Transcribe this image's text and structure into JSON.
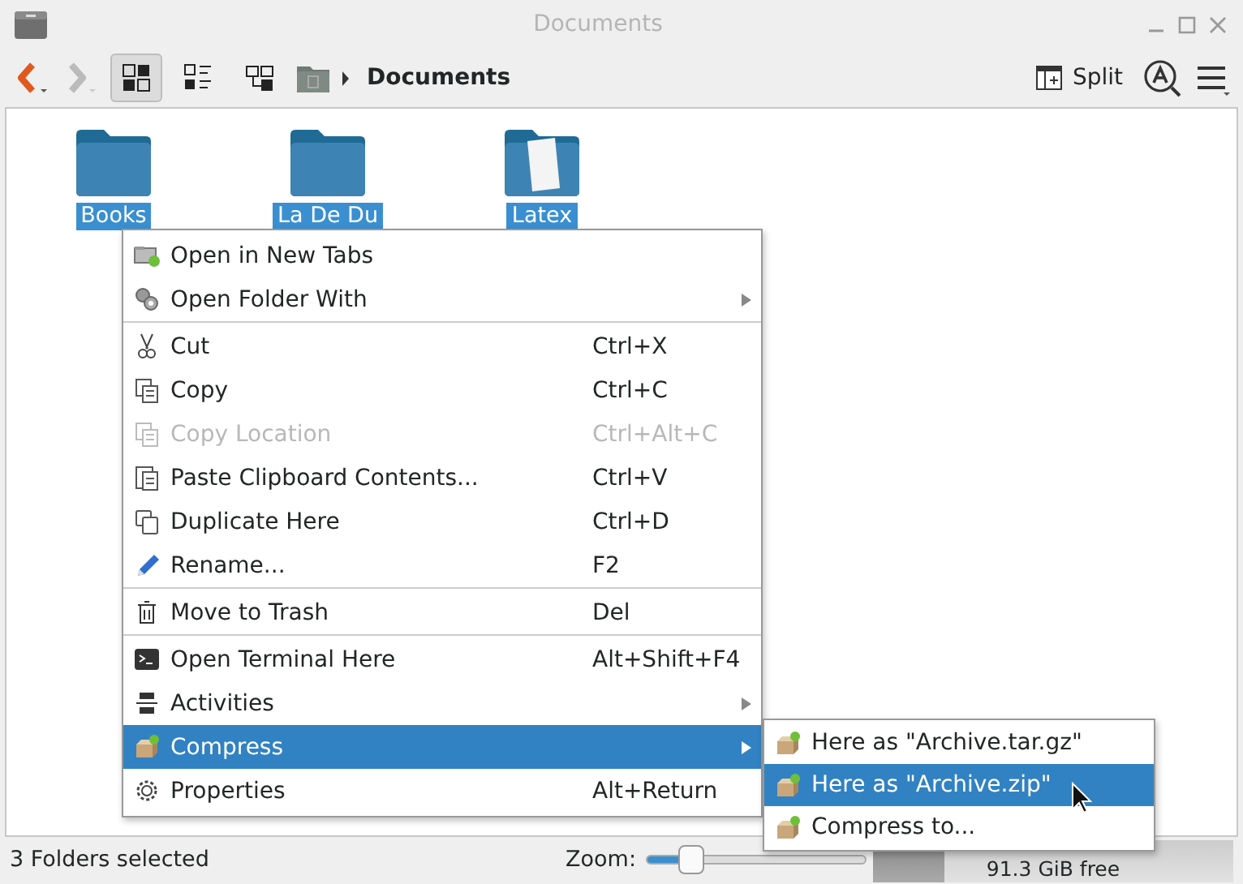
{
  "window": {
    "title": "Documents"
  },
  "toolbar": {
    "views": [
      {
        "selected": true
      },
      {
        "selected": false
      },
      {
        "selected": false
      }
    ],
    "breadcrumb": "Documents",
    "split_label": "Split"
  },
  "files": [
    {
      "name": "Books",
      "selected": true
    },
    {
      "name": "La De Du",
      "selected": true
    },
    {
      "name": "Latex",
      "selected": true
    }
  ],
  "context_menu": [
    {
      "label": "Open in New Tabs",
      "disabled": false,
      "selected": false,
      "submenu": false,
      "separator_after": false
    },
    {
      "label": "Open Folder With",
      "disabled": false,
      "selected": false,
      "submenu": true,
      "separator_after": true
    },
    {
      "label": "Cut",
      "shortcut": "Ctrl+X",
      "disabled": false,
      "selected": false,
      "submenu": false,
      "separator_after": false
    },
    {
      "label": "Copy",
      "shortcut": "Ctrl+C",
      "disabled": false,
      "selected": false,
      "submenu": false,
      "separator_after": false
    },
    {
      "label": "Copy Location",
      "shortcut": "Ctrl+Alt+C",
      "disabled": true,
      "selected": false,
      "submenu": false,
      "separator_after": false
    },
    {
      "label": "Paste Clipboard Contents...",
      "shortcut": "Ctrl+V",
      "disabled": false,
      "selected": false,
      "submenu": false,
      "separator_after": false
    },
    {
      "label": "Duplicate Here",
      "shortcut": "Ctrl+D",
      "disabled": false,
      "selected": false,
      "submenu": false,
      "separator_after": false
    },
    {
      "label": "Rename...",
      "shortcut": "F2",
      "disabled": false,
      "selected": false,
      "submenu": false,
      "separator_after": true
    },
    {
      "label": "Move to Trash",
      "shortcut": "Del",
      "disabled": false,
      "selected": false,
      "submenu": false,
      "separator_after": true
    },
    {
      "label": "Open Terminal Here",
      "shortcut": "Alt+Shift+F4",
      "disabled": false,
      "selected": false,
      "submenu": false,
      "separator_after": false
    },
    {
      "label": "Activities",
      "disabled": false,
      "selected": false,
      "submenu": true,
      "separator_after": false
    },
    {
      "label": "Compress",
      "disabled": false,
      "selected": true,
      "submenu": true,
      "separator_after": false
    },
    {
      "label": "Properties",
      "shortcut": "Alt+Return",
      "disabled": false,
      "selected": false,
      "submenu": false,
      "separator_after": false
    }
  ],
  "submenu": [
    {
      "label": "Here as \"Archive.tar.gz\"",
      "selected": false
    },
    {
      "label": "Here as \"Archive.zip\"",
      "selected": true
    },
    {
      "label": "Compress to...",
      "selected": false
    }
  ],
  "status_bar": {
    "text": "3 Folders selected",
    "zoom_label": "Zoom:",
    "zoom": {
      "level": 0.2
    },
    "free_space": {
      "text": "91.3 GiB free",
      "level": 0.2
    }
  }
}
